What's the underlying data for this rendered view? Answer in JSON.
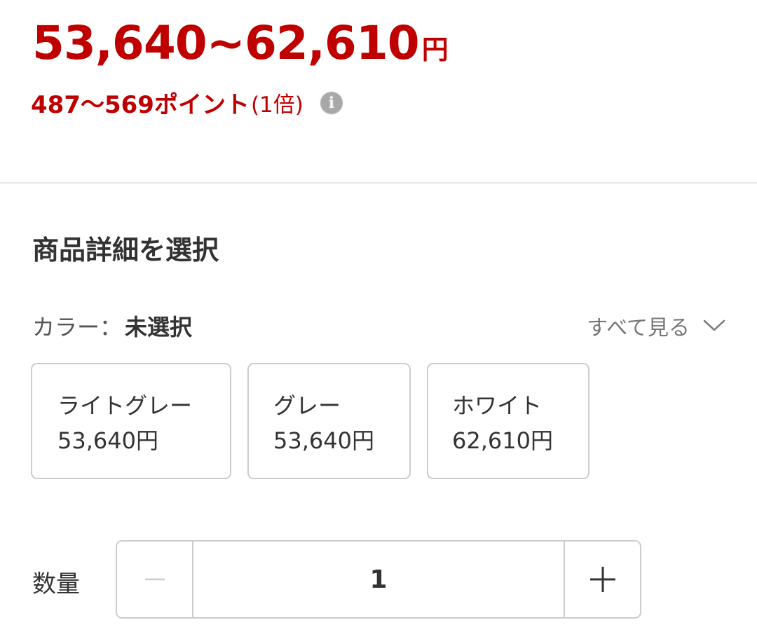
{
  "price": {
    "range": "53,640~62,610",
    "unit": "円"
  },
  "points": {
    "text": "487〜569ポイント",
    "multiplier": "(1倍)",
    "info_icon_glyph": "i"
  },
  "selection": {
    "title": "商品詳細を選択",
    "color_label": "カラー：",
    "color_value": "未選択",
    "see_all": "すべて見る",
    "options": [
      {
        "name": "ライトグレー",
        "price": "53,640円"
      },
      {
        "name": "グレー",
        "price": "53,640円"
      },
      {
        "name": "ホワイト",
        "price": "62,610円"
      }
    ]
  },
  "quantity": {
    "label": "数量",
    "value": "1"
  },
  "colors": {
    "price_red": "#bf0000",
    "border_gray": "#cccccc",
    "text_dark": "#333333",
    "icon_gray": "#a8a8a8"
  },
  "icons": [
    "info-icon",
    "chevron-down-icon",
    "minus-icon",
    "plus-icon"
  ]
}
